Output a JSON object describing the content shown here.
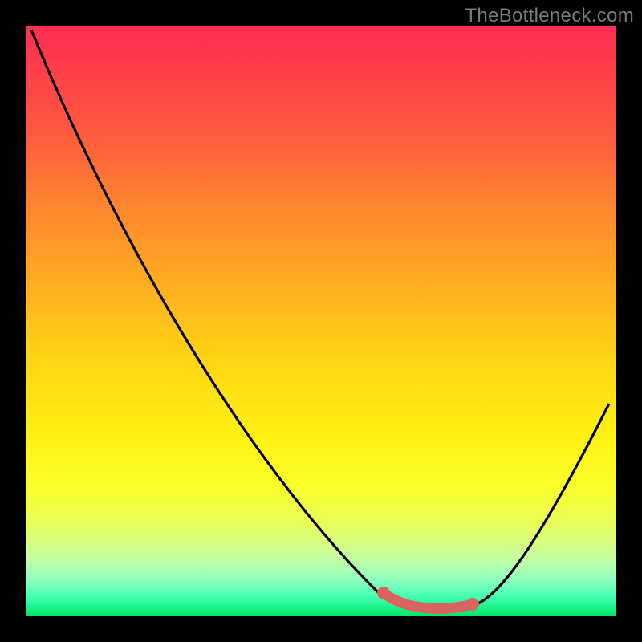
{
  "watermark": "TheBottleneck.com",
  "colors": {
    "background": "#000000",
    "curve": "#000000",
    "accent": "#d9645f",
    "watermark": "#7a7a7a",
    "gradient_top": "#ff2d55",
    "gradient_bottom": "#00e66a"
  },
  "chart_data": {
    "type": "line",
    "title": "",
    "xlabel": "",
    "ylabel": "",
    "xlim": [
      0,
      100
    ],
    "ylim": [
      0,
      100
    ],
    "grid": false,
    "legend": false,
    "series": [
      {
        "name": "bottleneck_response",
        "x": [
          0,
          5,
          10,
          15,
          20,
          25,
          30,
          35,
          40,
          45,
          50,
          55,
          60,
          62,
          66,
          70,
          74,
          78,
          82,
          86,
          90,
          95,
          100
        ],
        "y": [
          100,
          90,
          80,
          70,
          61,
          52,
          44,
          36,
          28,
          21,
          14,
          9,
          5,
          3,
          1.5,
          0.8,
          0.5,
          1.5,
          4,
          9,
          17,
          27,
          37
        ]
      }
    ],
    "optimal_zone": {
      "x_start": 62,
      "x_end": 77
    },
    "annotations": [],
    "background_gradient": {
      "orientation": "vertical",
      "stops": [
        {
          "pos": 0.0,
          "color": "#ff2d55"
        },
        {
          "pos": 0.18,
          "color": "#ff5a3e"
        },
        {
          "pos": 0.46,
          "color": "#ffb41f"
        },
        {
          "pos": 0.7,
          "color": "#fff213"
        },
        {
          "pos": 0.9,
          "color": "#c8ffa0"
        },
        {
          "pos": 1.0,
          "color": "#00e66a"
        }
      ]
    }
  }
}
